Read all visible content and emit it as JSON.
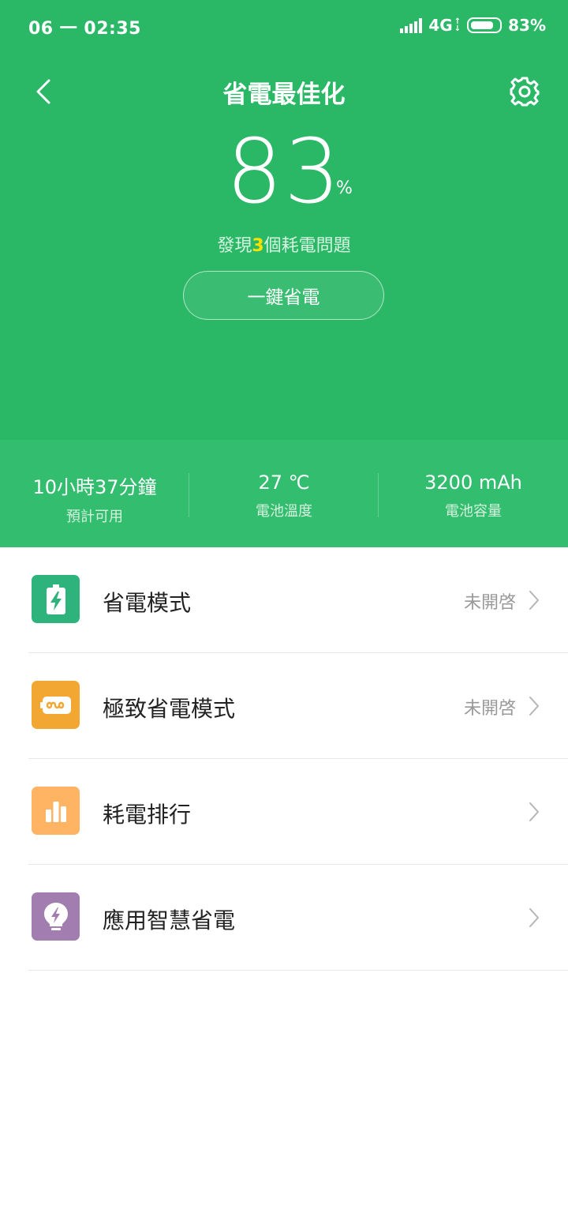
{
  "status_bar": {
    "time": "06 一 02:35",
    "network": "4G",
    "battery_text": "83%",
    "battery_level": 0.83,
    "icons": [
      "signal-icon",
      "data-arrows-icon",
      "battery-icon"
    ]
  },
  "header": {
    "title": "省電最佳化",
    "back_icon": "chevron-left-icon",
    "settings_icon": "gear-icon"
  },
  "battery": {
    "percent": "83",
    "unit": "%",
    "issues_prefix": "發現",
    "issues_count": "3",
    "issues_suffix": "個耗電問題",
    "action_label": "一鍵省電"
  },
  "stats": [
    {
      "value": "10小時37分鐘",
      "label": "預計可用"
    },
    {
      "value": "27 ℃",
      "label": "電池溫度"
    },
    {
      "value": "3200 mAh",
      "label": "電池容量"
    }
  ],
  "menu": [
    {
      "label": "省電模式",
      "status": "未開啓",
      "icon": "battery-bolt-icon",
      "color": "#2db37b"
    },
    {
      "label": "極致省電模式",
      "status": "未開啓",
      "icon": "infinity-battery-icon",
      "color": "#f3a733"
    },
    {
      "label": "耗電排行",
      "status": "",
      "icon": "bar-chart-icon",
      "color": "#ffb464"
    },
    {
      "label": "應用智慧省電",
      "status": "",
      "icon": "lightbulb-bolt-icon",
      "color": "#a27db0"
    }
  ],
  "colors": {
    "primary_green": "#2ab867",
    "stats_green": "#33bd6e",
    "highlight_yellow": "#ffe100"
  }
}
